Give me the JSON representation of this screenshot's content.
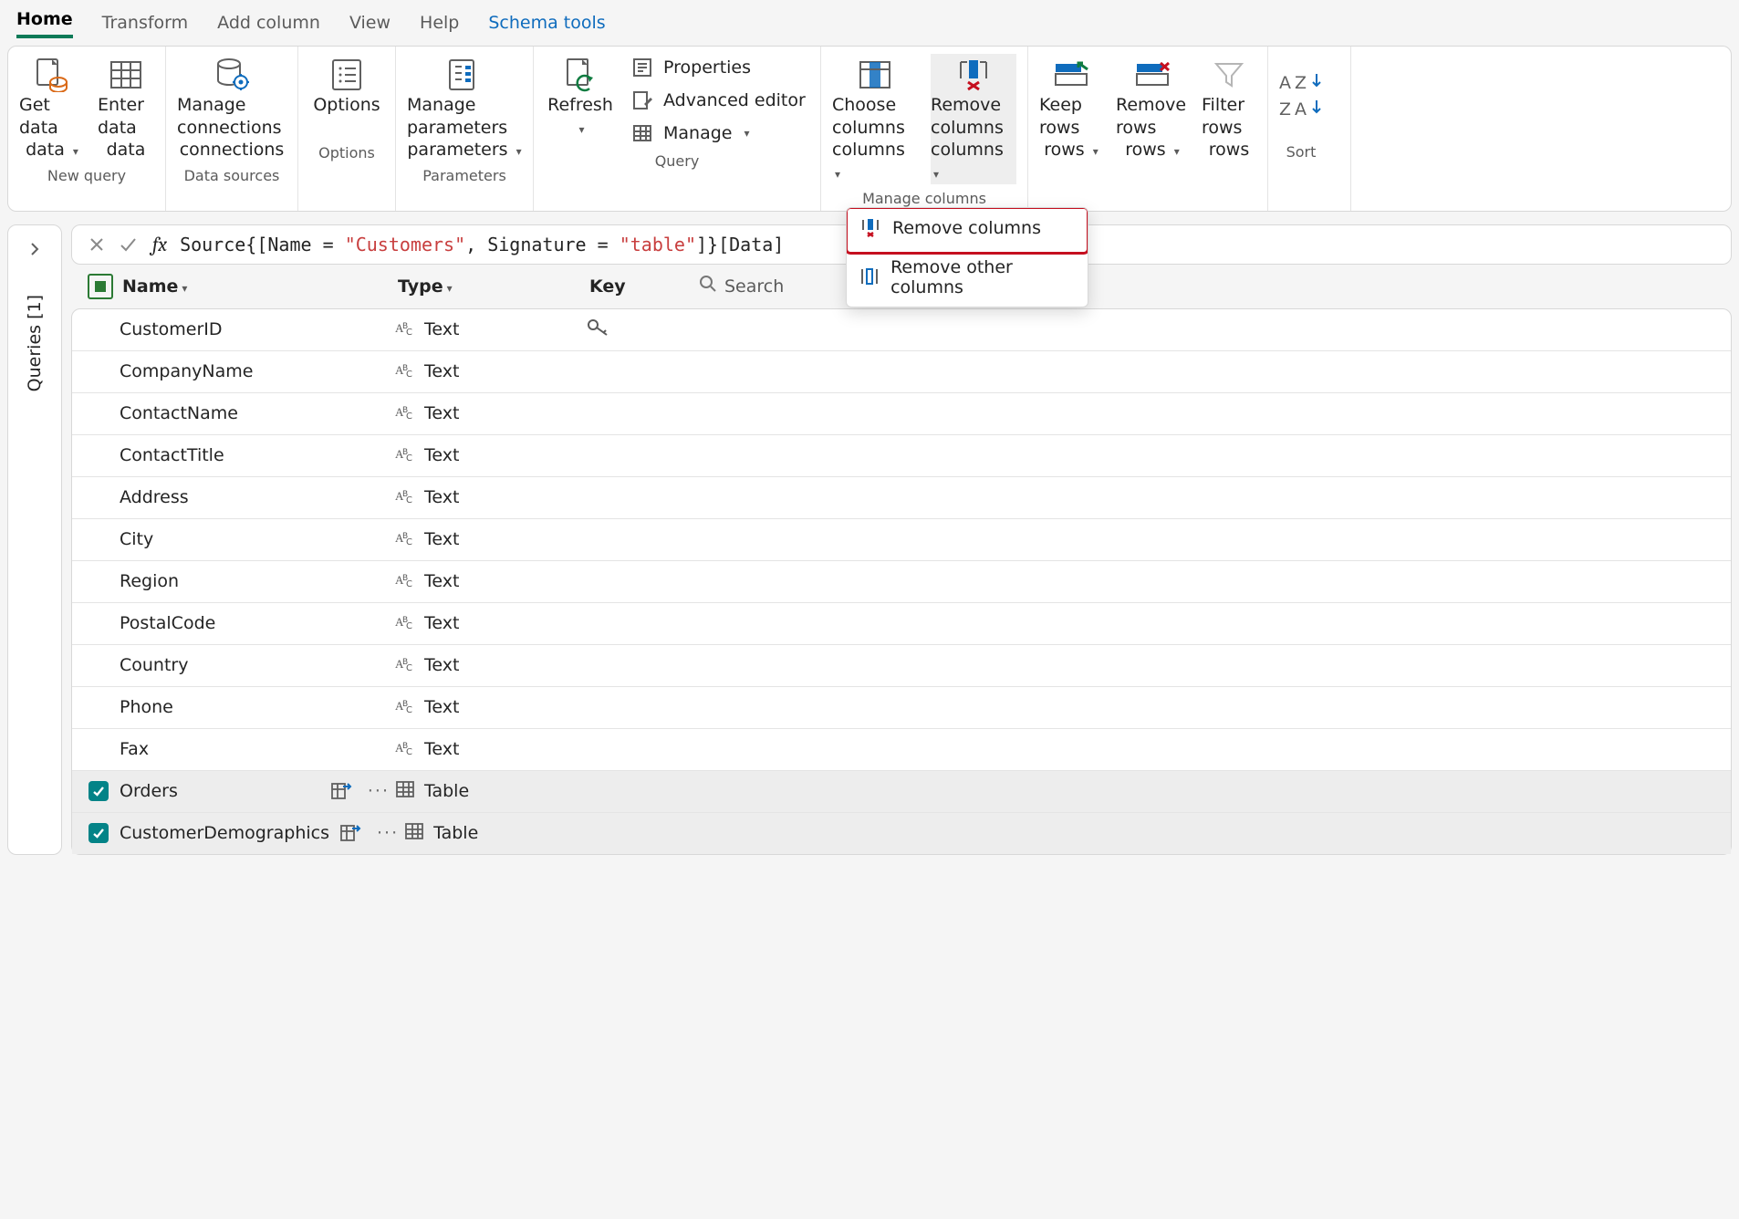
{
  "tabs": [
    {
      "label": "Home",
      "active": true
    },
    {
      "label": "Transform"
    },
    {
      "label": "Add column"
    },
    {
      "label": "View"
    },
    {
      "label": "Help"
    },
    {
      "label": "Schema tools",
      "accent": true
    }
  ],
  "ribbon": {
    "new_query": {
      "label": "New query",
      "get_data": "Get data",
      "enter_data": "Enter data"
    },
    "data_sources": {
      "label": "Data sources",
      "manage_connections": "Manage connections"
    },
    "options": {
      "label": "Options",
      "options": "Options"
    },
    "parameters": {
      "label": "Parameters",
      "manage_parameters": "Manage parameters"
    },
    "query": {
      "label": "Query",
      "refresh": "Refresh",
      "properties": "Properties",
      "advanced_editor": "Advanced editor",
      "manage": "Manage"
    },
    "manage_columns": {
      "label": "Manage columns",
      "choose_columns": "Choose columns",
      "remove_columns": "Remove columns"
    },
    "rows": {
      "keep": "Keep rows",
      "remove": "Remove rows",
      "filter": "Filter rows"
    },
    "sort": {
      "label": "Sort"
    }
  },
  "dropdown": {
    "remove_columns": "Remove columns",
    "remove_other": "Remove other columns"
  },
  "queries_pane": {
    "label": "Queries [1]"
  },
  "formula": {
    "plain1": "Source{[Name = ",
    "str1": "\"Customers\"",
    "plain2": ", Signature = ",
    "str2": "\"table\"",
    "plain3": "]}[Data]"
  },
  "headers": {
    "name": "Name",
    "type": "Type",
    "key": "Key",
    "search_placeholder": "Search"
  },
  "rows": [
    {
      "name": "CustomerID",
      "type": "Text",
      "kind": "text",
      "key": true
    },
    {
      "name": "CompanyName",
      "type": "Text",
      "kind": "text"
    },
    {
      "name": "ContactName",
      "type": "Text",
      "kind": "text"
    },
    {
      "name": "ContactTitle",
      "type": "Text",
      "kind": "text"
    },
    {
      "name": "Address",
      "type": "Text",
      "kind": "text"
    },
    {
      "name": "City",
      "type": "Text",
      "kind": "text"
    },
    {
      "name": "Region",
      "type": "Text",
      "kind": "text"
    },
    {
      "name": "PostalCode",
      "type": "Text",
      "kind": "text"
    },
    {
      "name": "Country",
      "type": "Text",
      "kind": "text"
    },
    {
      "name": "Phone",
      "type": "Text",
      "kind": "text"
    },
    {
      "name": "Fax",
      "type": "Text",
      "kind": "text"
    },
    {
      "name": "Orders",
      "type": "Table",
      "kind": "table",
      "selected": true,
      "nav": true
    },
    {
      "name": "CustomerDemographics",
      "type": "Table",
      "kind": "table",
      "selected": true,
      "nav": true
    }
  ]
}
